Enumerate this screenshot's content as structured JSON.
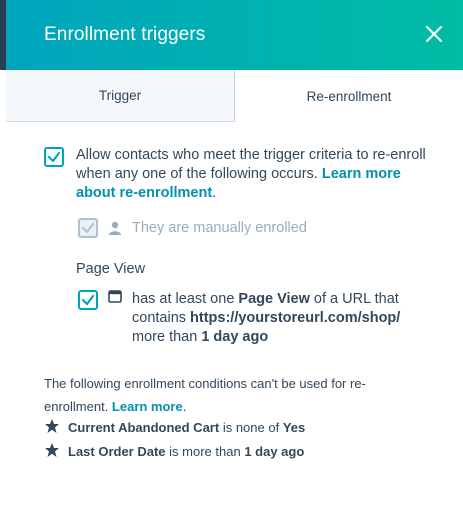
{
  "header": {
    "title": "Enrollment triggers"
  },
  "tabs": [
    {
      "label": "Trigger",
      "active": false
    },
    {
      "label": "Re-enrollment",
      "active": true
    }
  ],
  "main_option": {
    "checked": true,
    "text": "Allow contacts who meet the trigger criteria to re-enroll when any one of the following occurs.",
    "link": "Learn more about re-enrollment",
    "after_link": "."
  },
  "manual_option": {
    "checked": true,
    "disabled": true,
    "text": "They are manually enrolled"
  },
  "page_view": {
    "heading": "Page View",
    "checked": true,
    "text_1": "has at least one ",
    "bold_1": "Page View",
    "text_2": " of a URL that contains ",
    "bold_2": "https://yourstoreurl.com/shop/",
    "text_3": " more than ",
    "bold_3": "1 day ago"
  },
  "notice": {
    "text": "The following enrollment conditions can't be used for re-enrollment. ",
    "link": "Learn more",
    "after_link": "."
  },
  "conditions": [
    {
      "bold_name": "Current Abandoned Cart",
      "text": " is none of ",
      "bold_value": "Yes"
    },
    {
      "bold_name": "Last Order Date",
      "text": " is more than ",
      "bold_value": "1 day ago"
    }
  ],
  "colors": {
    "header_gradient_start": "#00a4bd",
    "header_gradient_end": "#00bda5",
    "link": "#0091ae",
    "text": "#33475b",
    "disabled_text": "#99acc2"
  }
}
